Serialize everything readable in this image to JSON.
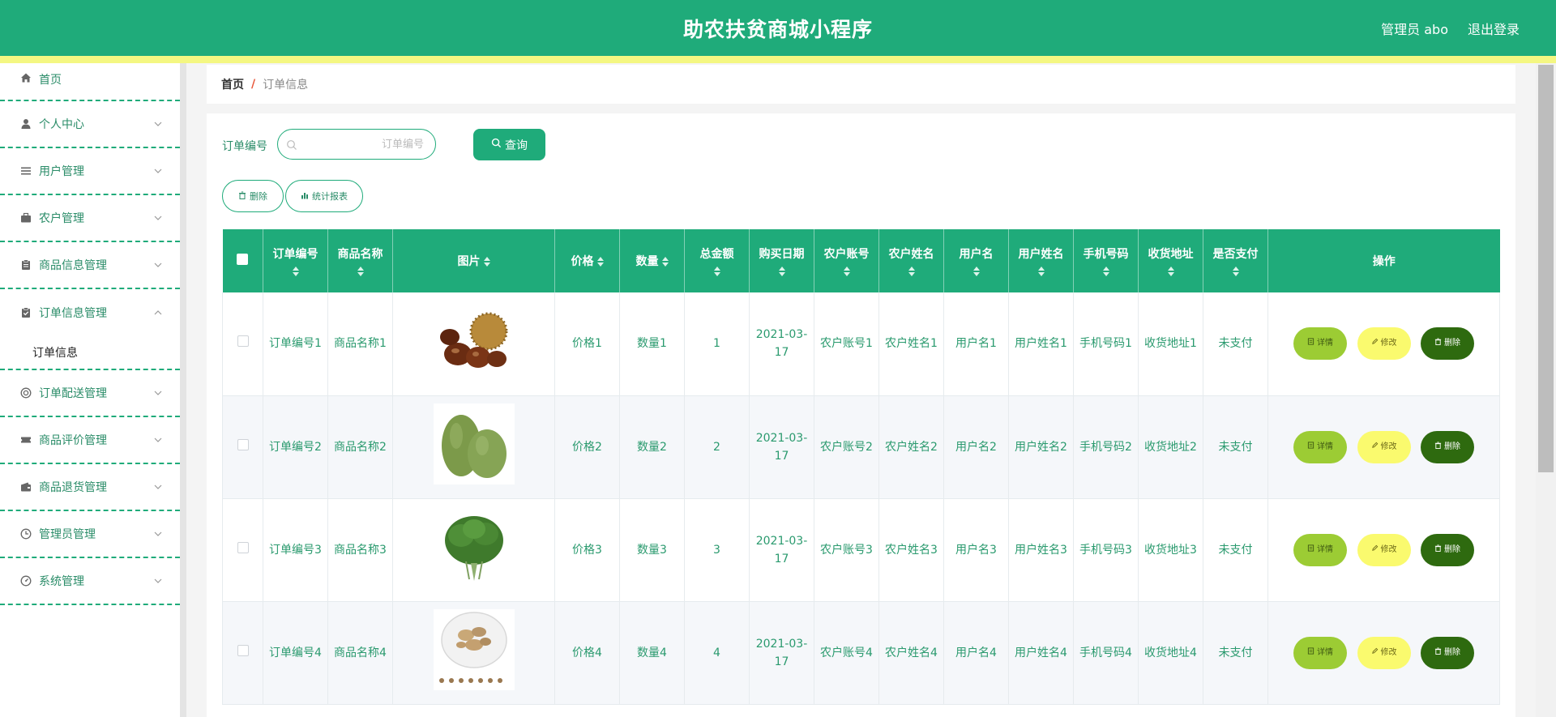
{
  "header": {
    "title": "助农扶贫商城小程序",
    "user": "管理员 abo",
    "logout": "退出登录"
  },
  "sidebar": {
    "items": [
      {
        "label": "首页",
        "icon": "home-icon"
      },
      {
        "label": "个人中心",
        "icon": "user-icon"
      },
      {
        "label": "用户管理",
        "icon": "list-icon"
      },
      {
        "label": "农户管理",
        "icon": "briefcase-icon"
      },
      {
        "label": "商品信息管理",
        "icon": "clipboard-icon"
      },
      {
        "label": "订单信息管理",
        "icon": "clipboard-check-icon",
        "submenu": "订单信息"
      },
      {
        "label": "订单配送管理",
        "icon": "lifebuoy-icon"
      },
      {
        "label": "商品评价管理",
        "icon": "ticket-icon"
      },
      {
        "label": "商品退货管理",
        "icon": "wallet-icon"
      },
      {
        "label": "管理员管理",
        "icon": "clock-icon"
      },
      {
        "label": "系统管理",
        "icon": "gauge-icon"
      }
    ]
  },
  "breadcrumb": {
    "home": "首页",
    "sep": "/",
    "current": "订单信息"
  },
  "search": {
    "label": "订单编号",
    "placeholder": "订单编号",
    "button": "查询"
  },
  "actions": {
    "delete": "删除",
    "report": "统计报表"
  },
  "table": {
    "headers": [
      "订单编号",
      "商品名称",
      "图片",
      "价格",
      "数量",
      "总金额",
      "购买日期",
      "农户账号",
      "农户姓名",
      "用户名",
      "用户姓名",
      "手机号码",
      "收货地址",
      "是否支付",
      "操作"
    ],
    "row_buttons": {
      "detail": "详情",
      "edit": "修改",
      "delete": "删除"
    },
    "rows": [
      {
        "order_no": "订单编号1",
        "product": "商品名称1",
        "image": "chestnut-image",
        "price": "价格1",
        "qty": "数量1",
        "total": "1",
        "date": "2021-03-17",
        "farmer_acc": "农户账号1",
        "farmer_name": "农户姓名1",
        "username": "用户名1",
        "user_name": "用户姓名1",
        "phone": "手机号码1",
        "address": "收货地址1",
        "paid": "未支付"
      },
      {
        "order_no": "订单编号2",
        "product": "商品名称2",
        "image": "winter-melon-image",
        "price": "价格2",
        "qty": "数量2",
        "total": "2",
        "date": "2021-03-17",
        "farmer_acc": "农户账号2",
        "farmer_name": "农户姓名2",
        "username": "用户名2",
        "user_name": "用户姓名2",
        "phone": "手机号码2",
        "address": "收货地址2",
        "paid": "未支付"
      },
      {
        "order_no": "订单编号3",
        "product": "商品名称3",
        "image": "spinach-image",
        "price": "价格3",
        "qty": "数量3",
        "total": "3",
        "date": "2021-03-17",
        "farmer_acc": "农户账号3",
        "farmer_name": "农户姓名3",
        "username": "用户名3",
        "user_name": "用户姓名3",
        "phone": "手机号码3",
        "address": "收货地址3",
        "paid": "未支付"
      },
      {
        "order_no": "订单编号4",
        "product": "商品名称4",
        "image": "ginger-image",
        "price": "价格4",
        "qty": "数量4",
        "total": "4",
        "date": "2021-03-17",
        "farmer_acc": "农户账号4",
        "farmer_name": "农户姓名4",
        "username": "用户名4",
        "user_name": "用户姓名4",
        "phone": "手机号码4",
        "address": "收货地址4",
        "paid": "未支付"
      }
    ]
  },
  "colors": {
    "primary": "#1fab7a",
    "strip": "#f4f782",
    "text_green": "#2a9a6e",
    "detail": "#9ccc34",
    "edit": "#fafa6e",
    "delete": "#2e6a0f"
  }
}
